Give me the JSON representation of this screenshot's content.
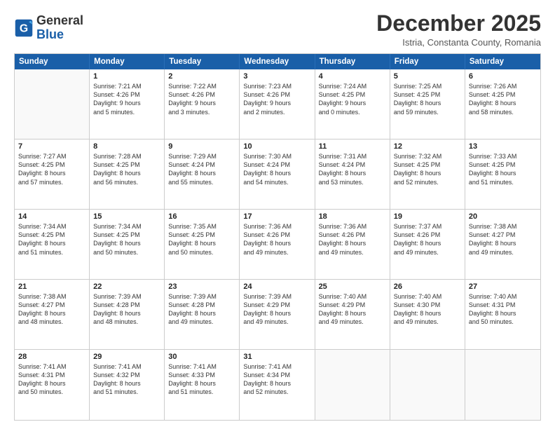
{
  "header": {
    "logo_general": "General",
    "logo_blue": "Blue",
    "month_title": "December 2025",
    "subtitle": "Istria, Constanta County, Romania"
  },
  "weekdays": [
    "Sunday",
    "Monday",
    "Tuesday",
    "Wednesday",
    "Thursday",
    "Friday",
    "Saturday"
  ],
  "rows": [
    [
      {
        "day": "",
        "text": ""
      },
      {
        "day": "1",
        "text": "Sunrise: 7:21 AM\nSunset: 4:26 PM\nDaylight: 9 hours\nand 5 minutes."
      },
      {
        "day": "2",
        "text": "Sunrise: 7:22 AM\nSunset: 4:26 PM\nDaylight: 9 hours\nand 3 minutes."
      },
      {
        "day": "3",
        "text": "Sunrise: 7:23 AM\nSunset: 4:26 PM\nDaylight: 9 hours\nand 2 minutes."
      },
      {
        "day": "4",
        "text": "Sunrise: 7:24 AM\nSunset: 4:25 PM\nDaylight: 9 hours\nand 0 minutes."
      },
      {
        "day": "5",
        "text": "Sunrise: 7:25 AM\nSunset: 4:25 PM\nDaylight: 8 hours\nand 59 minutes."
      },
      {
        "day": "6",
        "text": "Sunrise: 7:26 AM\nSunset: 4:25 PM\nDaylight: 8 hours\nand 58 minutes."
      }
    ],
    [
      {
        "day": "7",
        "text": "Sunrise: 7:27 AM\nSunset: 4:25 PM\nDaylight: 8 hours\nand 57 minutes."
      },
      {
        "day": "8",
        "text": "Sunrise: 7:28 AM\nSunset: 4:25 PM\nDaylight: 8 hours\nand 56 minutes."
      },
      {
        "day": "9",
        "text": "Sunrise: 7:29 AM\nSunset: 4:24 PM\nDaylight: 8 hours\nand 55 minutes."
      },
      {
        "day": "10",
        "text": "Sunrise: 7:30 AM\nSunset: 4:24 PM\nDaylight: 8 hours\nand 54 minutes."
      },
      {
        "day": "11",
        "text": "Sunrise: 7:31 AM\nSunset: 4:24 PM\nDaylight: 8 hours\nand 53 minutes."
      },
      {
        "day": "12",
        "text": "Sunrise: 7:32 AM\nSunset: 4:25 PM\nDaylight: 8 hours\nand 52 minutes."
      },
      {
        "day": "13",
        "text": "Sunrise: 7:33 AM\nSunset: 4:25 PM\nDaylight: 8 hours\nand 51 minutes."
      }
    ],
    [
      {
        "day": "14",
        "text": "Sunrise: 7:34 AM\nSunset: 4:25 PM\nDaylight: 8 hours\nand 51 minutes."
      },
      {
        "day": "15",
        "text": "Sunrise: 7:34 AM\nSunset: 4:25 PM\nDaylight: 8 hours\nand 50 minutes."
      },
      {
        "day": "16",
        "text": "Sunrise: 7:35 AM\nSunset: 4:25 PM\nDaylight: 8 hours\nand 50 minutes."
      },
      {
        "day": "17",
        "text": "Sunrise: 7:36 AM\nSunset: 4:26 PM\nDaylight: 8 hours\nand 49 minutes."
      },
      {
        "day": "18",
        "text": "Sunrise: 7:36 AM\nSunset: 4:26 PM\nDaylight: 8 hours\nand 49 minutes."
      },
      {
        "day": "19",
        "text": "Sunrise: 7:37 AM\nSunset: 4:26 PM\nDaylight: 8 hours\nand 49 minutes."
      },
      {
        "day": "20",
        "text": "Sunrise: 7:38 AM\nSunset: 4:27 PM\nDaylight: 8 hours\nand 49 minutes."
      }
    ],
    [
      {
        "day": "21",
        "text": "Sunrise: 7:38 AM\nSunset: 4:27 PM\nDaylight: 8 hours\nand 48 minutes."
      },
      {
        "day": "22",
        "text": "Sunrise: 7:39 AM\nSunset: 4:28 PM\nDaylight: 8 hours\nand 48 minutes."
      },
      {
        "day": "23",
        "text": "Sunrise: 7:39 AM\nSunset: 4:28 PM\nDaylight: 8 hours\nand 49 minutes."
      },
      {
        "day": "24",
        "text": "Sunrise: 7:39 AM\nSunset: 4:29 PM\nDaylight: 8 hours\nand 49 minutes."
      },
      {
        "day": "25",
        "text": "Sunrise: 7:40 AM\nSunset: 4:29 PM\nDaylight: 8 hours\nand 49 minutes."
      },
      {
        "day": "26",
        "text": "Sunrise: 7:40 AM\nSunset: 4:30 PM\nDaylight: 8 hours\nand 49 minutes."
      },
      {
        "day": "27",
        "text": "Sunrise: 7:40 AM\nSunset: 4:31 PM\nDaylight: 8 hours\nand 50 minutes."
      }
    ],
    [
      {
        "day": "28",
        "text": "Sunrise: 7:41 AM\nSunset: 4:31 PM\nDaylight: 8 hours\nand 50 minutes."
      },
      {
        "day": "29",
        "text": "Sunrise: 7:41 AM\nSunset: 4:32 PM\nDaylight: 8 hours\nand 51 minutes."
      },
      {
        "day": "30",
        "text": "Sunrise: 7:41 AM\nSunset: 4:33 PM\nDaylight: 8 hours\nand 51 minutes."
      },
      {
        "day": "31",
        "text": "Sunrise: 7:41 AM\nSunset: 4:34 PM\nDaylight: 8 hours\nand 52 minutes."
      },
      {
        "day": "",
        "text": ""
      },
      {
        "day": "",
        "text": ""
      },
      {
        "day": "",
        "text": ""
      }
    ]
  ]
}
